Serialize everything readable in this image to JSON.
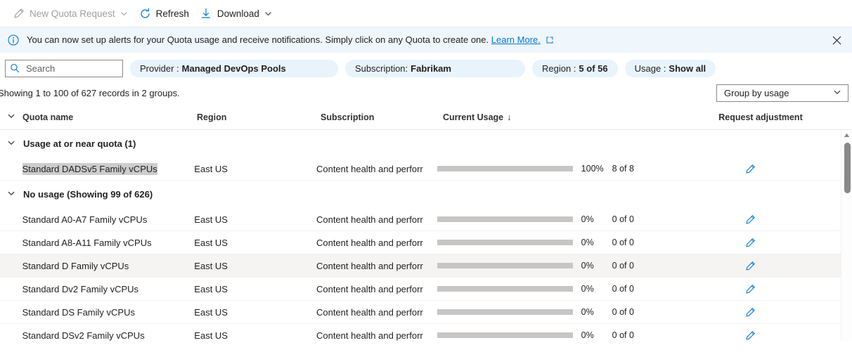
{
  "toolbar": {
    "new_quota_request": "New Quota Request",
    "refresh": "Refresh",
    "download": "Download"
  },
  "banner": {
    "message": "You can now set up alerts for your Quota usage and receive notifications. Simply click on any Quota to create one.",
    "link": "Learn More."
  },
  "filters": {
    "search_placeholder": "Search",
    "search_value": "",
    "chips": [
      {
        "label": "Provider :",
        "value": "Managed DevOps Pools"
      },
      {
        "label": "Subscription:",
        "value": "Fabrikam"
      },
      {
        "label": "Region :",
        "value": "5 of 56"
      },
      {
        "label": "Usage :",
        "value": "Show all"
      }
    ]
  },
  "summary": {
    "records_text": "Showing 1 to 100 of 627 records in 2 groups.",
    "group_by": "Group by usage"
  },
  "table": {
    "columns": {
      "quota_name": "Quota name",
      "region": "Region",
      "subscription": "Subscription",
      "current_usage": "Current Usage",
      "sort_arrow": "↓",
      "request_adjustment": "Request adjustment"
    },
    "groups": [
      {
        "title": "Usage at or near quota (1)",
        "rows": [
          {
            "name": "Standard DADSv5 Family vCPUs",
            "region": "East US",
            "subscription": "Content health and perforr",
            "percent": "100%",
            "percent_value": 100,
            "count": "8 of 8",
            "selected": true,
            "hovered": false
          }
        ]
      },
      {
        "title": "No usage (Showing 99 of 626)",
        "rows": [
          {
            "name": "Standard A0-A7 Family vCPUs",
            "region": "East US",
            "subscription": "Content health and perforr",
            "percent": "0%",
            "percent_value": 0,
            "count": "0 of 0",
            "selected": false,
            "hovered": false
          },
          {
            "name": "Standard A8-A11 Family vCPUs",
            "region": "East US",
            "subscription": "Content health and perforr",
            "percent": "0%",
            "percent_value": 0,
            "count": "0 of 0",
            "selected": false,
            "hovered": false
          },
          {
            "name": "Standard D Family vCPUs",
            "region": "East US",
            "subscription": "Content health and perforr",
            "percent": "0%",
            "percent_value": 0,
            "count": "0 of 0",
            "selected": false,
            "hovered": true
          },
          {
            "name": "Standard Dv2 Family vCPUs",
            "region": "East US",
            "subscription": "Content health and perforr",
            "percent": "0%",
            "percent_value": 0,
            "count": "0 of 0",
            "selected": false,
            "hovered": false
          },
          {
            "name": "Standard DS Family vCPUs",
            "region": "East US",
            "subscription": "Content health and perforr",
            "percent": "0%",
            "percent_value": 0,
            "count": "0 of 0",
            "selected": false,
            "hovered": false
          },
          {
            "name": "Standard DSv2 Family vCPUs",
            "region": "East US",
            "subscription": "Content health and perforr",
            "percent": "0%",
            "percent_value": 0,
            "count": "0 of 0",
            "selected": false,
            "hovered": false
          }
        ]
      }
    ]
  },
  "colors": {
    "accent": "#0078d4",
    "danger": "#e81123",
    "bar_track": "#c8c6c4",
    "banner_bg": "#eff6fc",
    "chip_bg": "#e8f3fc"
  }
}
